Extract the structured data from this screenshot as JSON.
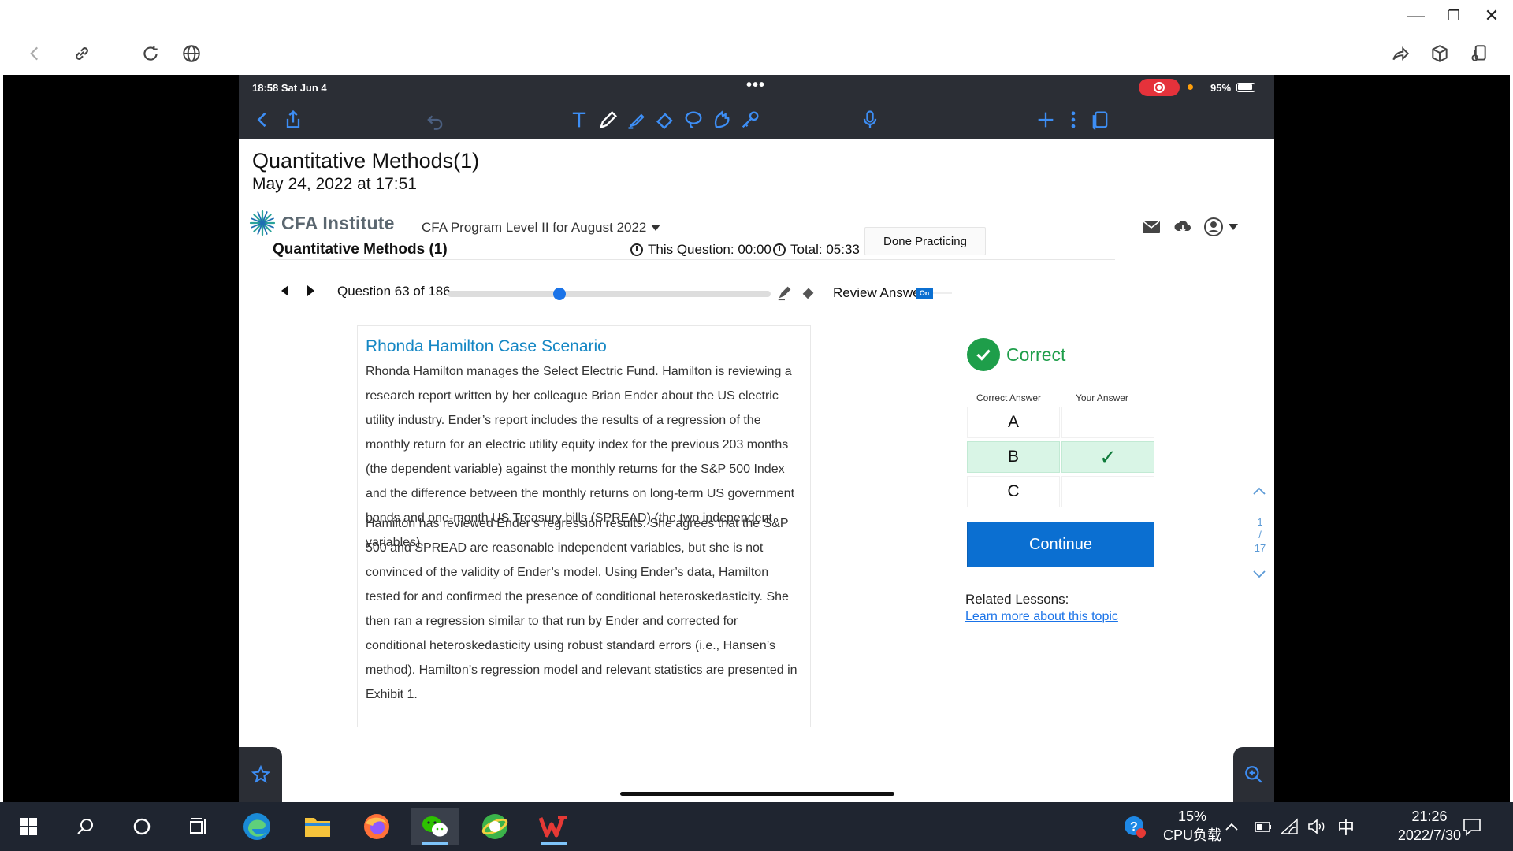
{
  "ipad": {
    "time": "18:58  Sat Jun 4",
    "battery": "95%",
    "menu_dots": "•••"
  },
  "document": {
    "title": "Quantitative Methods(1)",
    "date": "May 24, 2022 at 17:51"
  },
  "cfa": {
    "logo_text": "CFA Institute",
    "program": "CFA Program Level II for August 2022",
    "session_title": "Quantitative Methods (1)",
    "this_question": "This Question: 00:00",
    "total": "Total: 05:33",
    "done_button": "Done Practicing",
    "question_counter": "Question 63 of 186",
    "progress_fraction": 0.34,
    "review_answer_label": "Review Answer",
    "review_toggle": "On"
  },
  "scenario": {
    "title": "Rhonda Hamilton Case Scenario",
    "paragraphs": [
      "Rhonda Hamilton manages the Select Electric Fund. Hamilton is reviewing a research report written by her colleague Brian Ender about the US electric utility industry. Ender’s report includes the results of a regression of the monthly return for an electric utility equity index for the previous 203 months (the dependent variable) against the monthly returns for the S&P 500 Index and the difference between the monthly returns on long-term US government bonds and one-month US Treasury bills (SPREAD) (the two independent variables).",
      "Hamilton has reviewed Ender’s regression results. She agrees that the S&P 500 and SPREAD are reasonable independent variables, but she is not convinced of the validity of Ender’s model. Using Ender’s data, Hamilton tested for and confirmed the presence of conditional heteroskedasticity. She then ran a regression similar to that run by Ender and corrected for conditional heteroskedasticity using robust standard errors (i.e., Hansen’s method). Hamilton’s regression model and relevant statistics are presented in Exhibit 1."
    ]
  },
  "result": {
    "status": "Correct",
    "header_correct": "Correct Answer",
    "header_yours": "Your Answer",
    "options": [
      {
        "letter": "A",
        "mark": ""
      },
      {
        "letter": "B",
        "mark": "✓"
      },
      {
        "letter": "C",
        "mark": ""
      }
    ],
    "continue_button": "Continue",
    "related_label": "Related Lessons:",
    "related_link": "Learn more about this topic"
  },
  "page_indicator": {
    "current": "1",
    "separator": "/",
    "total": "17"
  },
  "taskbar": {
    "cpu_percent": "15%",
    "cpu_label": "CPU负载",
    "ime": "中",
    "time": "21:26",
    "date": "2022/7/30"
  },
  "colors": {
    "accent": "#0b6fd1",
    "correct_green": "#1e9e4a",
    "link_blue": "#1587c4",
    "ipad_toolbar": "#2b2e35"
  }
}
